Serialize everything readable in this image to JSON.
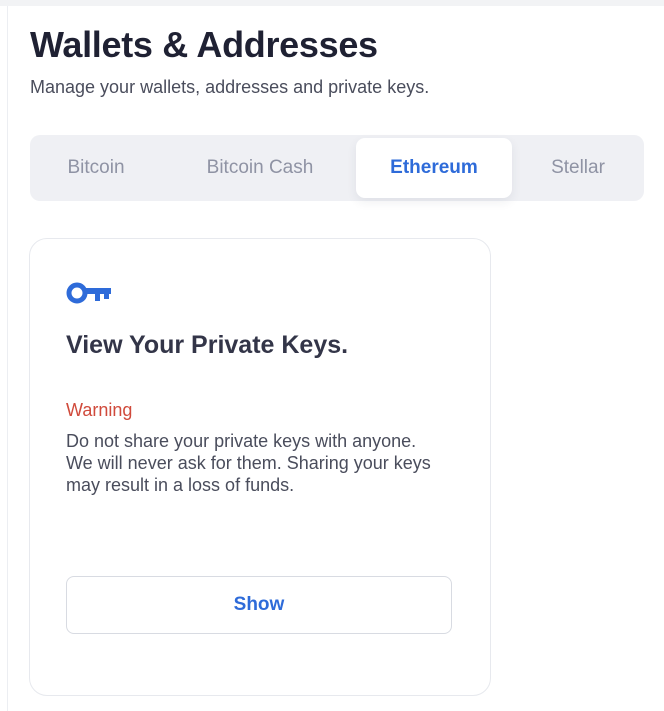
{
  "header": {
    "title": "Wallets & Addresses",
    "subtitle": "Manage your wallets, addresses and private keys."
  },
  "tabs": [
    {
      "label": "Bitcoin",
      "active": false
    },
    {
      "label": "Bitcoin Cash",
      "active": false
    },
    {
      "label": "Ethereum",
      "active": true
    },
    {
      "label": "Stellar",
      "active": false
    }
  ],
  "card": {
    "icon": "key-icon",
    "title": "View Your Private Keys.",
    "warning_label": "Warning",
    "warning_text": "Do not share your private keys with anyone. We will never ask for them. Sharing your keys may result in a loss of funds.",
    "button_label": "Show"
  },
  "colors": {
    "accent": "#2e6bd9",
    "warning": "#d04a3b",
    "heading": "#1f2133",
    "tab_inactive": "#8f93a4",
    "tab_bar": "#eff0f4"
  }
}
